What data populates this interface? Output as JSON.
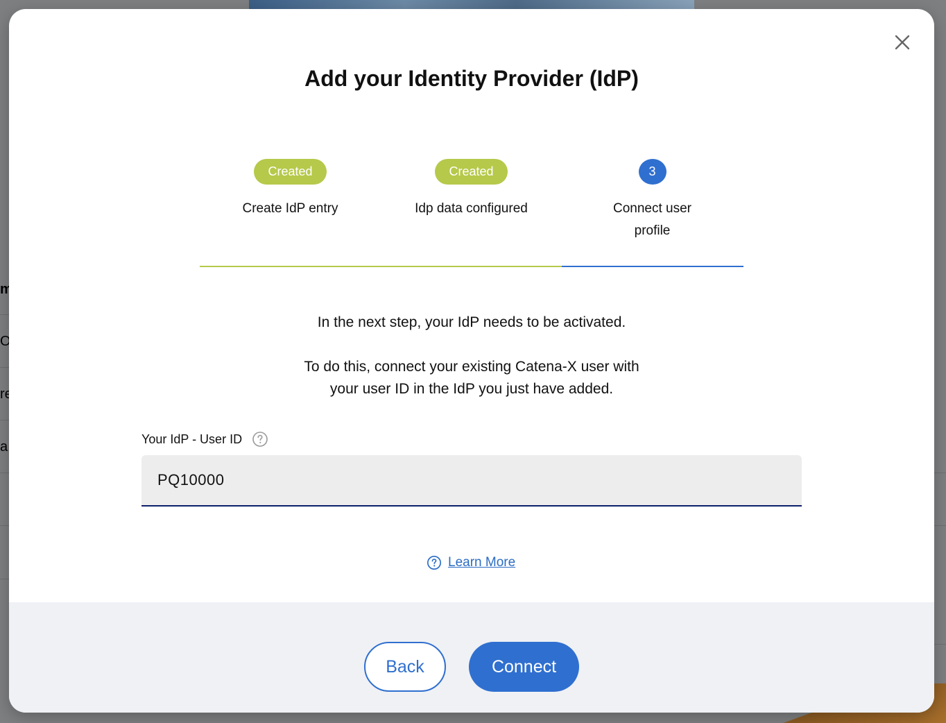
{
  "dialog": {
    "title": "Add your Identity Provider (IdP)",
    "close_icon": "close-icon"
  },
  "stepper": {
    "steps": [
      {
        "badge": "Created",
        "label": "Create IdP entry",
        "status": "done"
      },
      {
        "badge": "Created",
        "label": "Idp data configured",
        "status": "done"
      },
      {
        "badge": "3",
        "label": "Connect user profile",
        "status": "active"
      }
    ],
    "colors": {
      "done": "#b6c94a",
      "active": "#2f6fcf"
    }
  },
  "info": {
    "line1": "In the next step, your IdP needs to be activated.",
    "line2": "To do this, connect your existing Catena-X user with your user ID in the IdP you just have added."
  },
  "form": {
    "user_id_label": "Your IdP - User ID",
    "help_icon": "help-circle-icon",
    "user_id_value": "PQ10000"
  },
  "learn_more": {
    "icon": "help-circle-icon",
    "label": "Learn More"
  },
  "footer": {
    "back_label": "Back",
    "connect_label": "Connect"
  }
}
